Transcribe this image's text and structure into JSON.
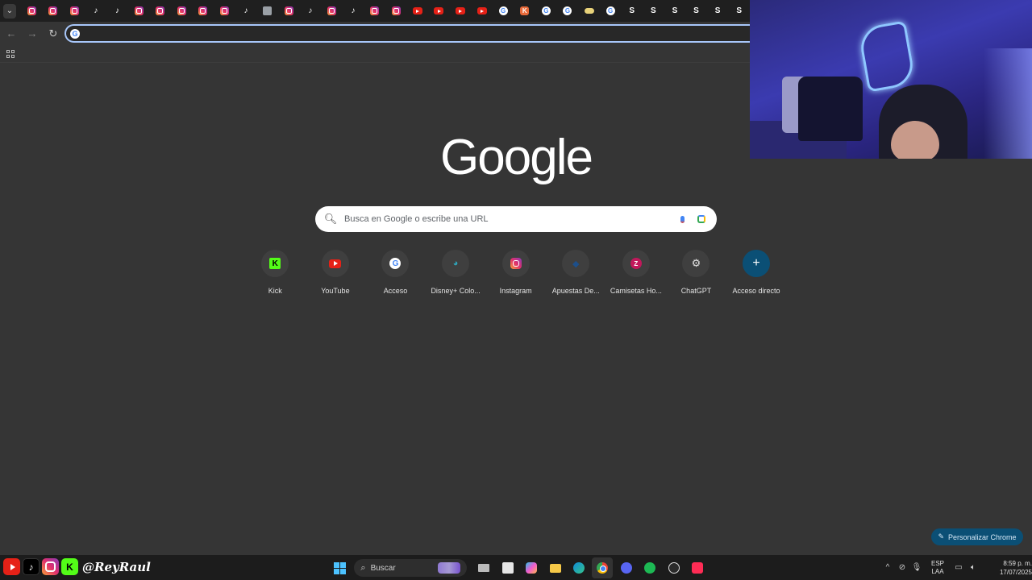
{
  "tabstrip": {
    "tabs": [
      {
        "icon": "instagram"
      },
      {
        "icon": "instagram"
      },
      {
        "icon": "instagram"
      },
      {
        "icon": "tiktok"
      },
      {
        "icon": "tiktok"
      },
      {
        "icon": "instagram"
      },
      {
        "icon": "instagram"
      },
      {
        "icon": "instagram"
      },
      {
        "icon": "instagram"
      },
      {
        "icon": "instagram"
      },
      {
        "icon": "tiktok"
      },
      {
        "icon": "doc"
      },
      {
        "icon": "instagram"
      },
      {
        "icon": "tiktok"
      },
      {
        "icon": "instagram"
      },
      {
        "icon": "tiktok"
      },
      {
        "icon": "instagram"
      },
      {
        "icon": "instagram"
      },
      {
        "icon": "youtube"
      },
      {
        "icon": "youtube"
      },
      {
        "icon": "youtube"
      },
      {
        "icon": "youtube"
      },
      {
        "icon": "google"
      },
      {
        "icon": "kick"
      },
      {
        "icon": "google"
      },
      {
        "icon": "google"
      },
      {
        "icon": "pill"
      },
      {
        "icon": "google"
      },
      {
        "icon": "letter-s"
      },
      {
        "icon": "letter-s"
      },
      {
        "icon": "letter-s"
      },
      {
        "icon": "letter-s"
      },
      {
        "icon": "letter-s"
      },
      {
        "icon": "letter-s"
      }
    ]
  },
  "omnibox": {
    "value": ""
  },
  "newtab": {
    "logo_text": "Google",
    "search_placeholder": "Busca en Google o escribe una URL",
    "shortcuts": [
      {
        "label": "Kick",
        "icon": "kick"
      },
      {
        "label": "YouTube",
        "icon": "youtube"
      },
      {
        "label": "Acceso",
        "icon": "google"
      },
      {
        "label": "Disney+ Colo...",
        "icon": "disney"
      },
      {
        "label": "Instagram",
        "icon": "instagram"
      },
      {
        "label": "Apuestas De...",
        "icon": "bet"
      },
      {
        "label": "Camisetas Ho...",
        "icon": "z"
      },
      {
        "label": "ChatGPT",
        "icon": "chatgpt"
      },
      {
        "label": "Acceso directo",
        "icon": "plus"
      }
    ],
    "customize_label": "Personalizar Chrome"
  },
  "taskbar": {
    "handle": "@ReyRaul",
    "search_label": "Buscar",
    "language_line1": "ESP",
    "language_line2": "LAA",
    "time": "8:59 p. m.",
    "date": "17/07/2025"
  },
  "colors": {
    "page_bg": "#353535",
    "accent": "#0b4f75",
    "omnibox_focus": "#a8c7fa"
  }
}
